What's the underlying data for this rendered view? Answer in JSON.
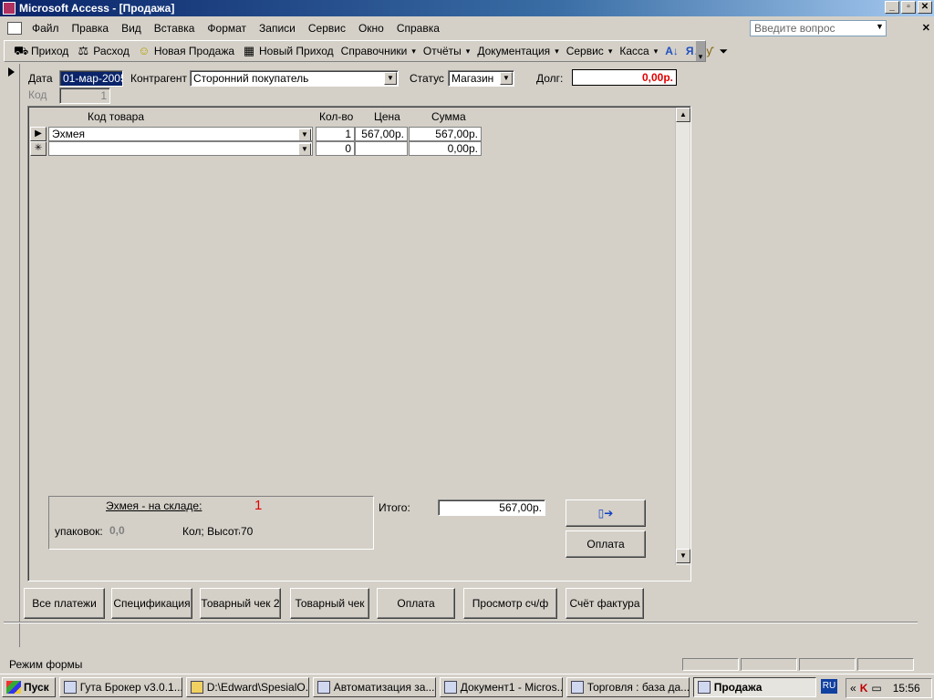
{
  "window": {
    "title": "Microsoft Access - [Продажа]",
    "btn_min": "_",
    "btn_restore": "▫",
    "btn_close": "✕"
  },
  "menu": [
    "Файл",
    "Правка",
    "Вид",
    "Вставка",
    "Формат",
    "Записи",
    "Сервис",
    "Окно",
    "Справка"
  ],
  "help_placeholder": "Введите вопрос",
  "toolbar": {
    "prihod": "Приход",
    "rashod": "Расход",
    "new_sale": "Новая Продажа",
    "new_prihod": "Новый Приход",
    "spravochniki": "Справочники",
    "otchety": "Отчёты",
    "dokumentacia": "Документация",
    "servis": "Сервис",
    "kassa": "Касса"
  },
  "form": {
    "date_label": "Дата",
    "date_value": "01-мар-2005",
    "contragent_label": "Контрагент",
    "contragent_value": "Сторонний покупатель",
    "status_label": "Статус",
    "status_value": "Магазин",
    "debt_label": "Долг:",
    "debt_value": "0,00р.",
    "code_label": "Код",
    "code_value": "1"
  },
  "grid": {
    "headers": {
      "code": "Код товара",
      "qty": "Кол-во",
      "price": "Цена",
      "sum": "Сумма"
    },
    "rows": [
      {
        "selector": "▶",
        "code": "Эхмея",
        "qty": "1",
        "price": "567,00р.",
        "sum": "567,00р."
      },
      {
        "selector": "✳",
        "code": "",
        "qty": "0",
        "price": "",
        "sum": "0,00р."
      }
    ]
  },
  "stock": {
    "title": "Эхмея - на складе:",
    "count": "1",
    "packs_label": "упаковок:",
    "packs_value": "0,0",
    "qty_label": "Кол; Высота",
    "qty_value": "70"
  },
  "total": {
    "label": "Итого:",
    "value": "567,00р."
  },
  "buttons": {
    "oplata_side": "Оплата",
    "vse_platezhi": "Все платежи",
    "specifikacia": "Спецификация",
    "tov_chek2": "Товарный чек 2",
    "tov_chek": "Товарный чек",
    "oplata": "Оплата",
    "prosmotr": "Просмотр сч/ф",
    "schet": "Счёт фактура"
  },
  "status_text": "Режим формы",
  "taskbar": {
    "start": "Пуск",
    "tasks": [
      "Гута Брокер v3.0.1...",
      "D:\\Edward\\SpesialO...",
      "Автоматизация за...",
      "Документ1 - Micros...",
      "Торговля : база да...",
      "Продажа"
    ],
    "lang": "RU",
    "time": "15:56"
  }
}
